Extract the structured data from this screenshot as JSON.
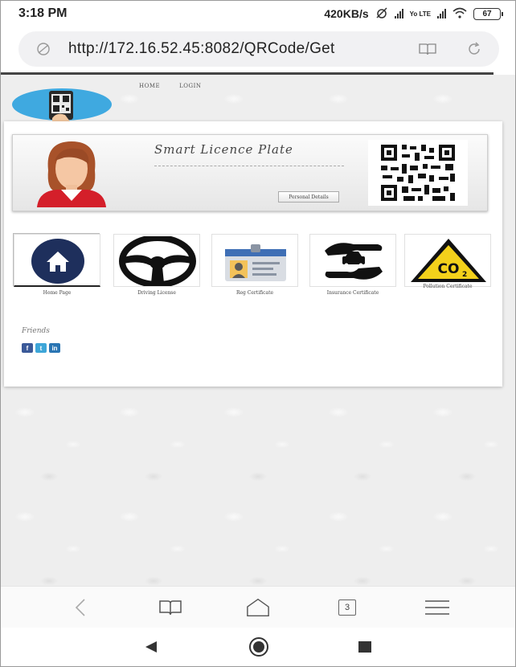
{
  "status_bar": {
    "time": "3:18 PM",
    "speed": "420KB/s",
    "network_label": "Yo LTE",
    "battery": "67"
  },
  "browser": {
    "url": "http://172.16.52.45:8082/QRCode/Get",
    "tab_count": "3"
  },
  "site": {
    "nav": [
      "HOME",
      "LOGIN"
    ],
    "brand_title": "Smart Licence Plate",
    "personal_button": "Personal Details",
    "tiles": [
      {
        "label": "Home Page",
        "icon": "home-icon"
      },
      {
        "label": "Driving License",
        "icon": "steering-wheel-icon"
      },
      {
        "label": "Reg Certificate",
        "icon": "id-card-icon"
      },
      {
        "label": "Insurance Certificate",
        "icon": "insured-car-icon"
      },
      {
        "label": "Pollution Certificate",
        "icon": "co2-warning-icon"
      }
    ],
    "friends_label": "Friends",
    "social": [
      {
        "name": "facebook",
        "glyph": "f",
        "color": "#3b5998"
      },
      {
        "name": "twitter",
        "glyph": "t",
        "color": "#3ea6d8"
      },
      {
        "name": "linkedin",
        "glyph": "in",
        "color": "#2a75b3"
      }
    ]
  },
  "colors": {
    "status_text": "#222222",
    "url_bar_bg": "#f1f1f3",
    "page_bg": "#eeeeee",
    "home_icon_bg": "#1e2f5c",
    "co2_yellow": "#f3d11b",
    "avatar_hair": "#a8522a",
    "avatar_shirt": "#d41f2a"
  }
}
